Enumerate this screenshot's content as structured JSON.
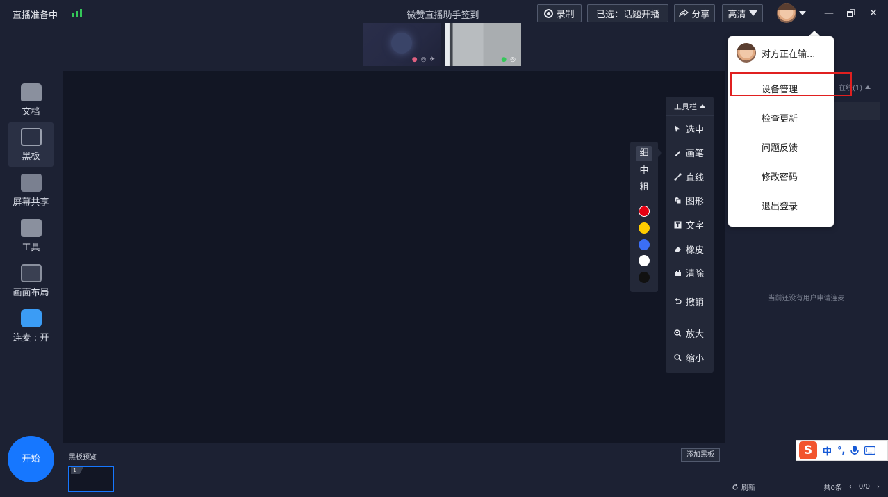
{
  "topbar": {
    "status": "直播准备中",
    "title": "微赞直播助手签到",
    "record_label": "录制",
    "selected_label": "已选：话题开播",
    "share_label": "分享",
    "quality_label": "高清",
    "window_controls": [
      "minimize-icon",
      "restore-icon",
      "close-icon"
    ]
  },
  "sidebar": {
    "items": [
      {
        "label": "文档",
        "icon": "folder-icon"
      },
      {
        "label": "黑板",
        "icon": "blackboard-icon",
        "active": true
      },
      {
        "label": "屏幕共享",
        "icon": "screen-share-icon"
      },
      {
        "label": "工具",
        "icon": "toolbox-icon"
      },
      {
        "label": "画面布局",
        "icon": "layout-icon"
      },
      {
        "label": "连麦 : 开",
        "icon": "chat-icon"
      }
    ],
    "start_label": "开始"
  },
  "toolbar": {
    "header": "工具栏",
    "tools": [
      {
        "label": "选中",
        "icon": "cursor-icon"
      },
      {
        "label": "画笔",
        "icon": "pen-icon"
      },
      {
        "label": "直线",
        "icon": "line-icon"
      },
      {
        "label": "图形",
        "icon": "shape-icon"
      },
      {
        "label": "文字",
        "icon": "text-icon"
      },
      {
        "label": "橡皮",
        "icon": "eraser-icon"
      },
      {
        "label": "清除",
        "icon": "clear-icon"
      },
      {
        "label": "撤销",
        "icon": "undo-icon"
      },
      {
        "label": "放大",
        "icon": "zoom-in-icon"
      },
      {
        "label": "缩小",
        "icon": "zoom-out-icon"
      }
    ]
  },
  "pen_panel": {
    "sizes": [
      "细",
      "中",
      "粗"
    ],
    "selected_size": "细",
    "colors": [
      "#e60012",
      "#ffcc00",
      "#3b6ef5",
      "#ffffff",
      "#111111"
    ]
  },
  "board": {
    "preview_label": "黑板预览",
    "add_label": "添加黑板",
    "thumb_number": "1"
  },
  "right_panel": {
    "online_tab": "在线(1)",
    "empty_text": "当前还没有用户申请连麦",
    "refresh_label": "刷新",
    "total_label": "共0条",
    "page_label": "0/0"
  },
  "menu": {
    "user_status": "对方正在输...",
    "items": [
      "设备管理",
      "检查更新",
      "问题反馈",
      "修改密码",
      "退出登录"
    ],
    "highlighted_item": "设备管理"
  },
  "ime": {
    "logo": "S",
    "items": [
      "中",
      "°,",
      "mic-icon",
      "keyboard-icon"
    ]
  }
}
